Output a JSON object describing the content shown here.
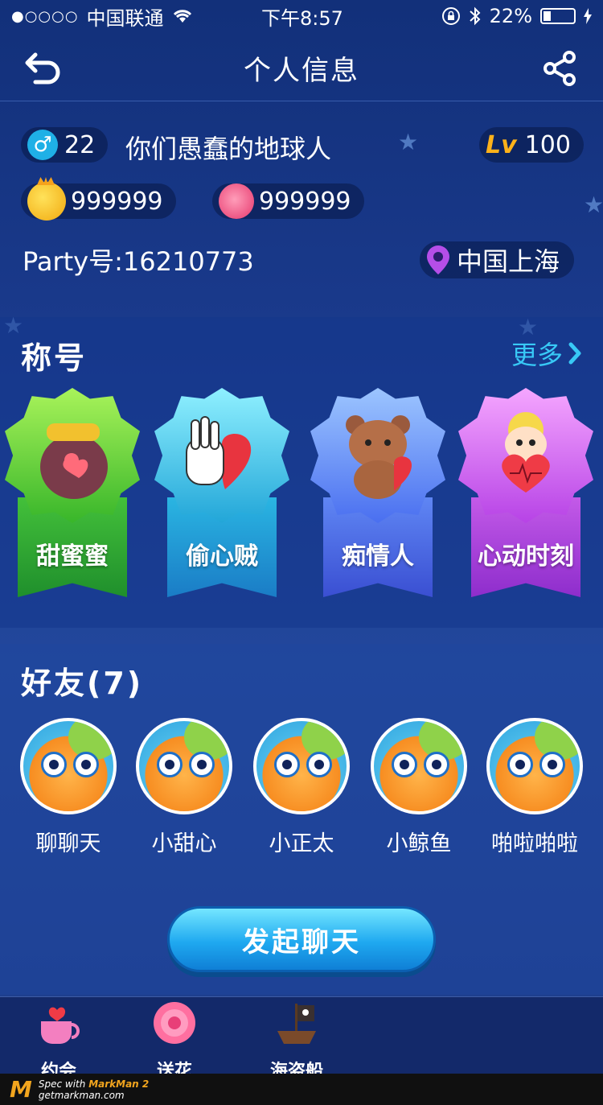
{
  "status_bar": {
    "signal": "●○○○○",
    "carrier": "中国联通",
    "time": "下午8:57",
    "battery": "22%"
  },
  "nav": {
    "title": "个人信息"
  },
  "profile": {
    "gender_level": "22",
    "nickname": "你们愚蠢的地球人",
    "lv_badge": "Lv",
    "level": "100",
    "gold": "999999",
    "flowers": "999999",
    "party_id": "Party号:16210773",
    "location": "中国上海"
  },
  "titles_section": {
    "heading": "称号",
    "more": "更多",
    "badges": [
      {
        "label": "甜蜜蜜"
      },
      {
        "label": "偷心贼"
      },
      {
        "label": "痴情人"
      },
      {
        "label": "心动时刻"
      }
    ]
  },
  "friends_section": {
    "heading": "好友(7)",
    "friends": [
      {
        "name": "聊聊天"
      },
      {
        "name": "小甜心"
      },
      {
        "name": "小正太"
      },
      {
        "name": "小鲸鱼"
      },
      {
        "name": "啪啦啪啦"
      }
    ]
  },
  "chat_button": "发起聊天",
  "tabs": [
    {
      "label": "约会",
      "icon": "teacup-hearts-icon"
    },
    {
      "label": "送花",
      "icon": "rose-icon"
    },
    {
      "label": "海盗船",
      "icon": "pirate-ship-icon"
    }
  ],
  "footer": {
    "logo": "M",
    "line1_prefix": "Spec with ",
    "line1_brand": "MarkMan 2",
    "line2": "getmarkman.com"
  },
  "colors": {
    "accent": "#38c9f6",
    "gold": "#ffb21a",
    "background": "#1a3a8c"
  }
}
